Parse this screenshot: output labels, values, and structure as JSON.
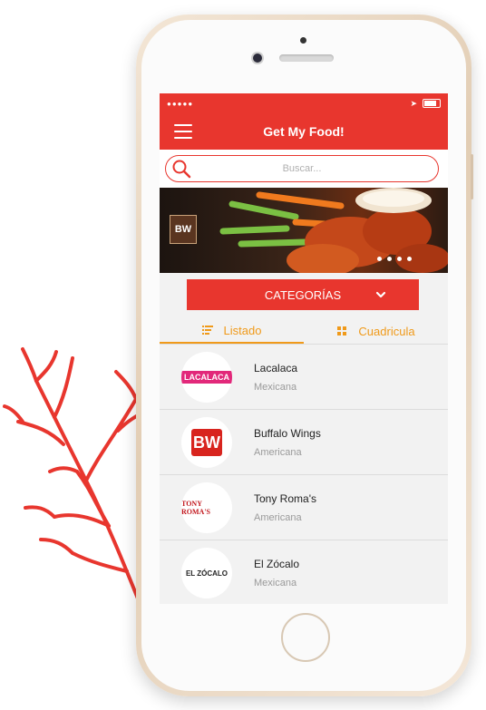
{
  "status_bar": {
    "signal": "●●●●●"
  },
  "app_bar": {
    "title": "Get My Food!"
  },
  "search": {
    "placeholder": "Buscar..."
  },
  "banner": {
    "logo_text": "BW",
    "slide_count": 4
  },
  "categories_button": {
    "label": "CATEGORÍAS"
  },
  "tabs": [
    {
      "label": "Listado",
      "icon": "list-icon",
      "active": true
    },
    {
      "label": "Cuadricula",
      "icon": "grid-icon",
      "active": false
    }
  ],
  "restaurants": [
    {
      "name": "Lacalaca",
      "category": "Mexicana",
      "logo_text": "LACALACA"
    },
    {
      "name": "Buffalo Wings",
      "category": "Americana",
      "logo_text": "BW"
    },
    {
      "name": "Tony Roma's",
      "category": "Americana",
      "logo_text": "TONY ROMA'S"
    },
    {
      "name": "El Zócalo",
      "category": "Mexicana",
      "logo_text": "EL ZÓCALO"
    }
  ],
  "colors": {
    "brand_red": "#e8362e",
    "tab_orange": "#f09a1a"
  }
}
